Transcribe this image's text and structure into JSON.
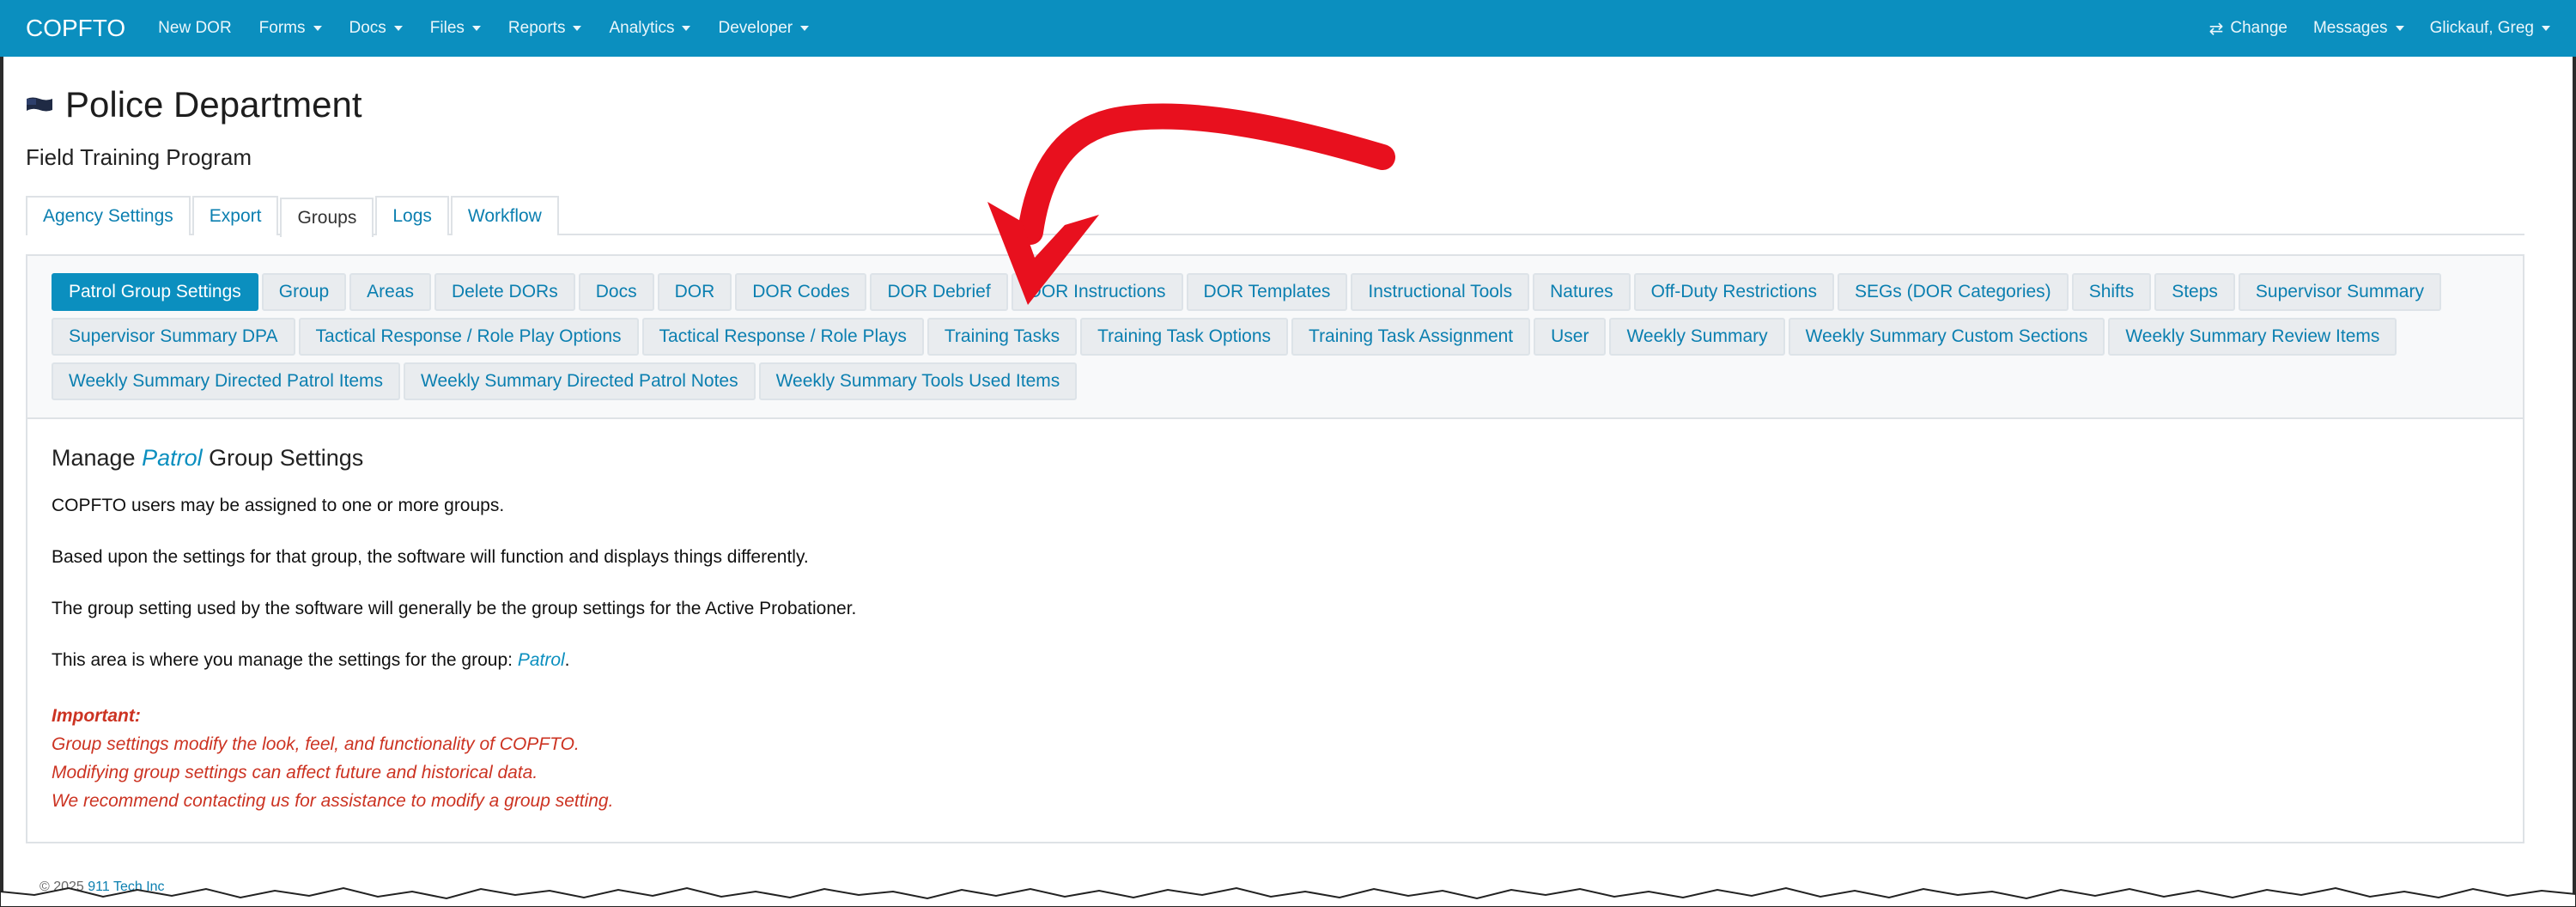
{
  "navbar": {
    "brand": "COPFTO",
    "items": [
      "New DOR",
      "Forms",
      "Docs",
      "Files",
      "Reports",
      "Analytics",
      "Developer"
    ],
    "right": {
      "change": "Change",
      "messages": "Messages",
      "user": "Glickauf, Greg"
    }
  },
  "header": {
    "title": "Police Department",
    "subtitle": "Field Training Program"
  },
  "tabs": [
    "Agency Settings",
    "Export",
    "Groups",
    "Logs",
    "Workflow"
  ],
  "active_tab": "Groups",
  "pills": [
    "Patrol Group Settings",
    "Group",
    "Areas",
    "Delete DORs",
    "Docs",
    "DOR",
    "DOR Codes",
    "DOR Debrief",
    "DOR Instructions",
    "DOR Templates",
    "Instructional Tools",
    "Natures",
    "Off-Duty Restrictions",
    "SEGs (DOR Categories)",
    "Shifts",
    "Steps",
    "Supervisor Summary",
    "Supervisor Summary DPA",
    "Tactical Response / Role Play Options",
    "Tactical Response / Role Plays",
    "Training Tasks",
    "Training Task Options",
    "Training Task Assignment",
    "User",
    "Weekly Summary",
    "Weekly Summary Custom Sections",
    "Weekly Summary Review Items",
    "Weekly Summary Directed Patrol Items",
    "Weekly Summary Directed Patrol Notes",
    "Weekly Summary Tools Used Items"
  ],
  "active_pill": "Patrol Group Settings",
  "content": {
    "manage_prefix": "Manage",
    "group_name": "Patrol",
    "manage_suffix": "Group Settings",
    "p1": "COPFTO users may be assigned to one or more groups.",
    "p2": "Based upon the settings for that group, the software will function and displays things differently.",
    "p3": "The group setting used by the software will generally be the group settings for the Active Probationer.",
    "p4_prefix": "This area is where you manage the settings for the group:",
    "p4_group": "Patrol",
    "p4_suffix": ".",
    "important_head": "Important:",
    "important_lines": [
      "Group settings modify the look, feel, and functionality of COPFTO.",
      "Modifying group settings can affect future and historical data.",
      "We recommend contacting us for assistance to modify a group setting."
    ]
  },
  "footer": {
    "copyright": "© 2025",
    "company": "911 Tech Inc"
  },
  "colors": {
    "navbar": "#0b8fbf",
    "link": "#0b7fb0",
    "important": "#cc3322",
    "arrow": "#e8101e"
  },
  "icons": [
    "swap-icon",
    "caret-down-icon",
    "flag-icon",
    "annotation-arrow"
  ]
}
